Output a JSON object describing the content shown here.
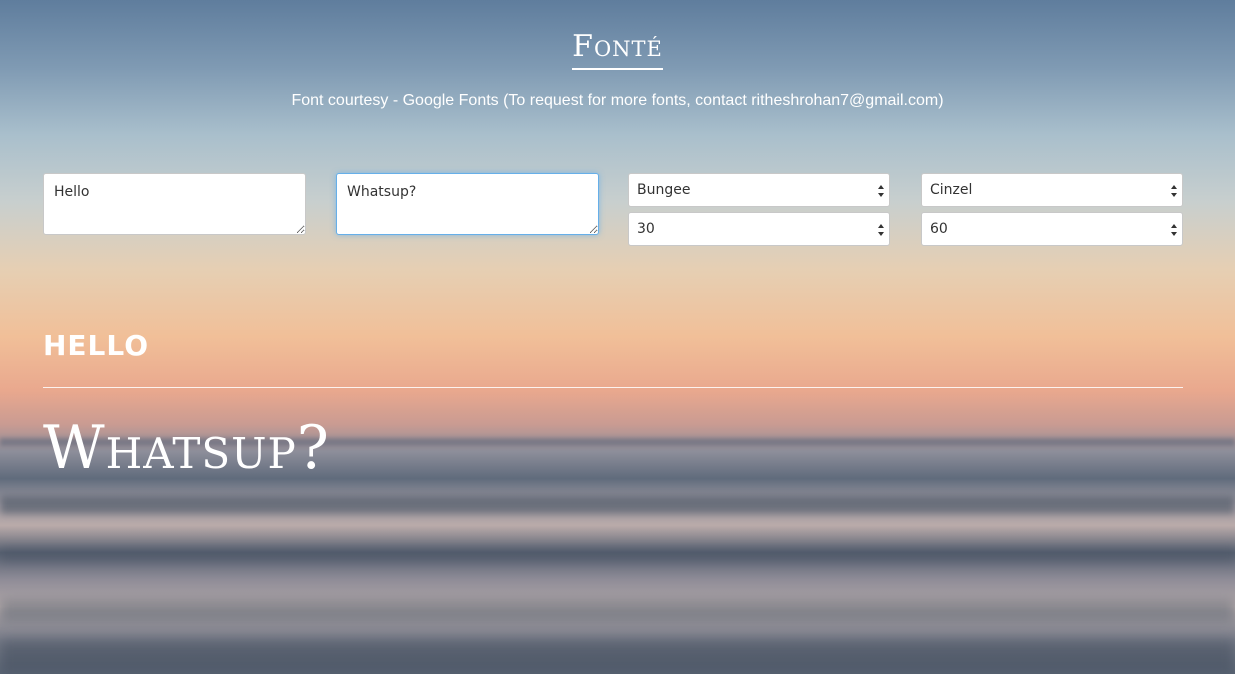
{
  "header": {
    "title": "Fonté",
    "subtitle": "Font courtesy - Google Fonts (To request for more fonts, contact ritheshrohan7@gmail.com)"
  },
  "inputs": {
    "text1": "Hello",
    "text2": "Whatsup?",
    "font1": "Bungee",
    "size1": "30",
    "font2": "Cinzel",
    "size2": "60"
  },
  "preview": {
    "text1": "HELLO",
    "text2": "Whatsup?"
  },
  "icons": {
    "select_arrow": "up-down-chevron-icon"
  },
  "colors": {
    "focus_border": "#66afe9",
    "text": "#ffffff"
  }
}
